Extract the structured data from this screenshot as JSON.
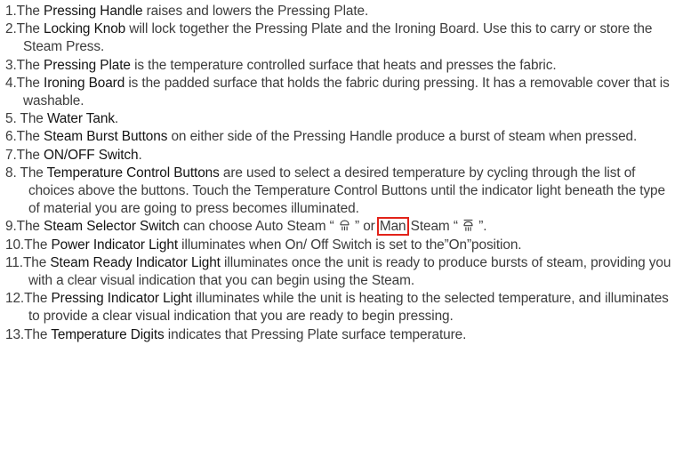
{
  "items": [
    {
      "num": "1.",
      "pre": "The ",
      "term": "Pressing Handle",
      "post": " raises and lowers the Pressing Plate."
    },
    {
      "num": "2.",
      "pre": "The ",
      "term": "Locking Knob",
      "post": " will lock together the Pressing Plate and the  Ironing  Board. Use this to carry or store the Steam Press."
    },
    {
      "num": "3.",
      "pre": "The ",
      "term": "Pressing Plate",
      "post": " is the temperature controlled surface that heats and presses the fabric."
    },
    {
      "num": "4.",
      "pre": "The ",
      "term": "Ironing Board",
      "post": " is the padded surface that holds the fabric during pressing. It has a removable cover that is washable."
    },
    {
      "num": "5.",
      "pre": " The ",
      "term": "Water Tank",
      "post": "."
    },
    {
      "num": "6.",
      "pre": "The ",
      "term": "Steam Burst Buttons",
      "post": " on either side of the Pressing Handle produce a burst of steam when pressed."
    },
    {
      "num": "7.",
      "pre": "The ",
      "term": "ON/OFF Switch",
      "post": "."
    },
    {
      "num": "8.",
      "pre": " The ",
      "term": "Temperature Control Buttons",
      "post": " are used to select a desired temperature by cycling through the list of choices above the buttons. Touch the Temperature Control Buttons until the indicator light beneath the type of material you are going to press becomes illuminated."
    },
    {
      "num": "9.",
      "pre": "The ",
      "term": "Steam Selector Switch",
      "post_a": " can choose Auto Steam “ ",
      "post_b": " ” or ",
      "highlight": "Man",
      "post_c": " Steam “ ",
      "post_d": " ”."
    },
    {
      "num": "10.",
      "pre": "The ",
      "term": "Power Indicator Light",
      "post": " illuminates when On/ Off Switch is set to the”On”position."
    },
    {
      "num": "11.",
      "pre": "The ",
      "term": "Steam Ready Indicator Light",
      "post": " illuminates once the unit is ready to produce bursts of steam, providing you with a clear visual indication that you can begin using the Steam."
    },
    {
      "num": "12.",
      "pre": "The ",
      "term": "Pressing Indicator Light",
      "post": " illuminates while the unit is heating to the selected temperature, and illuminates to provide a clear visual indication that you are ready to begin pressing."
    },
    {
      "num": "13.",
      "pre": "The ",
      "term": "Temperature Digits",
      "post": " indicates that Pressing Plate surface temperature."
    }
  ],
  "icons": {
    "auto_steam": "auto-steam-icon",
    "manual_steam": "manual-steam-icon"
  }
}
